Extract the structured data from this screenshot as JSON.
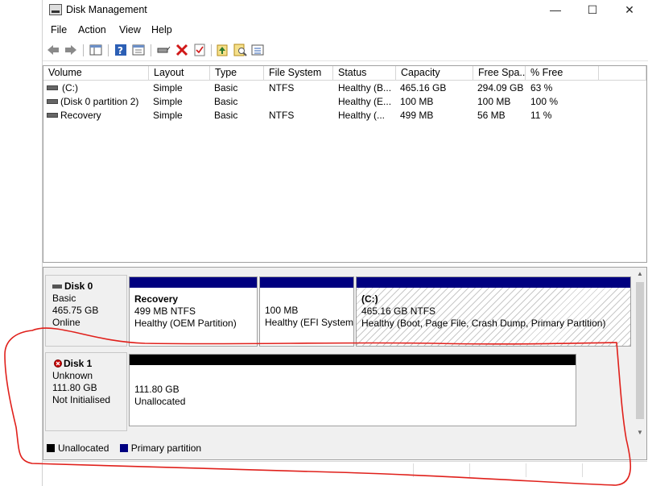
{
  "window": {
    "title": "Disk Management",
    "icon": "disk-management-icon"
  },
  "window_controls": {
    "minimize": "—",
    "maximize": "☐",
    "close": "✕"
  },
  "menu": [
    "File",
    "Action",
    "View",
    "Help"
  ],
  "toolbar_icons": [
    "back-arrow-icon",
    "forward-arrow-icon",
    "console-tree-icon",
    "help-icon",
    "properties-icon",
    "connect-icon",
    "delete-icon",
    "checkmark-icon",
    "export-icon",
    "search-icon",
    "list-view-icon"
  ],
  "columns": [
    "Volume",
    "Layout",
    "Type",
    "File System",
    "Status",
    "Capacity",
    "Free Spa...",
    "% Free"
  ],
  "volumes": [
    [
      "(C:)",
      "Simple",
      "Basic",
      "NTFS",
      "Healthy (B...",
      "465.16 GB",
      "294.09 GB",
      "63 %"
    ],
    [
      "(Disk 0 partition 2)",
      "Simple",
      "Basic",
      "",
      "Healthy (E...",
      "100 MB",
      "100 MB",
      "100 %"
    ],
    [
      "Recovery",
      "Simple",
      "Basic",
      "NTFS",
      "Healthy (...",
      "499 MB",
      "56 MB",
      "11 %"
    ]
  ],
  "disks": [
    {
      "name": "Disk 0",
      "type": "Basic",
      "size": "465.75 GB",
      "state": "Online",
      "partitions": [
        {
          "title": "Recovery",
          "line1": "499 MB NTFS",
          "line2": "Healthy (OEM Partition)"
        },
        {
          "title": "",
          "line1": "100 MB",
          "line2": "Healthy (EFI System"
        },
        {
          "title": "(C:)",
          "line1": "465.16 GB NTFS",
          "line2": "Healthy (Boot, Page File, Crash Dump, Primary Partition)"
        }
      ]
    },
    {
      "name": "Disk 1",
      "type": "Unknown",
      "size": "111.80 GB",
      "state": "Not Initialised",
      "partitions": [
        {
          "title": "",
          "line1": "111.80 GB",
          "line2": "Unallocated"
        }
      ]
    }
  ],
  "legend": [
    {
      "label": "Unallocated",
      "color": "#000000"
    },
    {
      "label": "Primary partition",
      "color": "#000080"
    }
  ],
  "colors": {
    "primary_bar": "#000080",
    "unallocated_bar": "#000000",
    "annotation": "#e0201b"
  }
}
